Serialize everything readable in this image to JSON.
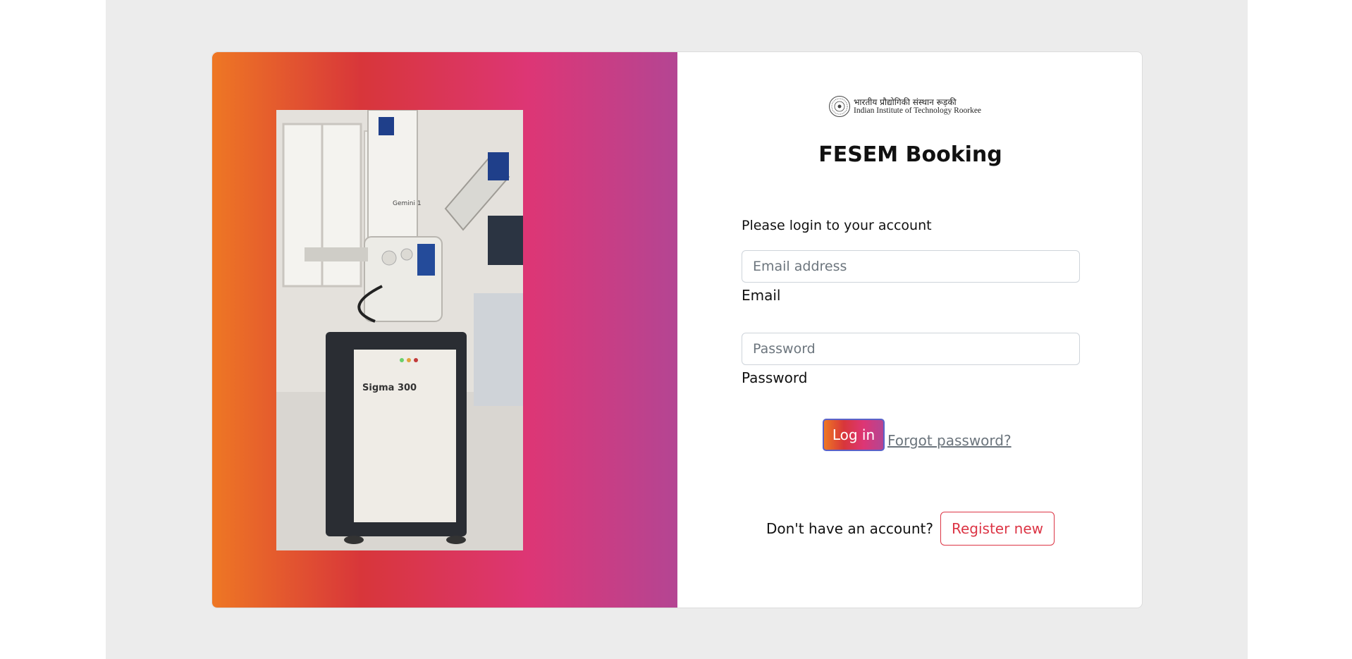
{
  "brand": {
    "logo_hindi": "भारतीय प्रौद्योगिकी संस्थान रूड़की",
    "logo_english": "Indian Institute of Technology Roorkee"
  },
  "page": {
    "title": "FESEM Booking",
    "prompt": "Please login to your account"
  },
  "form": {
    "email": {
      "placeholder": "Email address",
      "label": "Email",
      "value": ""
    },
    "password": {
      "placeholder": "Password",
      "label": "Password",
      "value": ""
    },
    "login_label": "Log in",
    "forgot_label": "Forgot password?"
  },
  "register": {
    "text": "Don't have an account?",
    "button_label": "Register new"
  },
  "colors": {
    "gradient": [
      "#ee7724",
      "#d8363a",
      "#dd3675",
      "#b44593"
    ],
    "register_accent": "#dc3545",
    "page_background": "#ececec"
  },
  "icons": {
    "logo_emblem": "iit-roorkee-emblem-icon"
  }
}
